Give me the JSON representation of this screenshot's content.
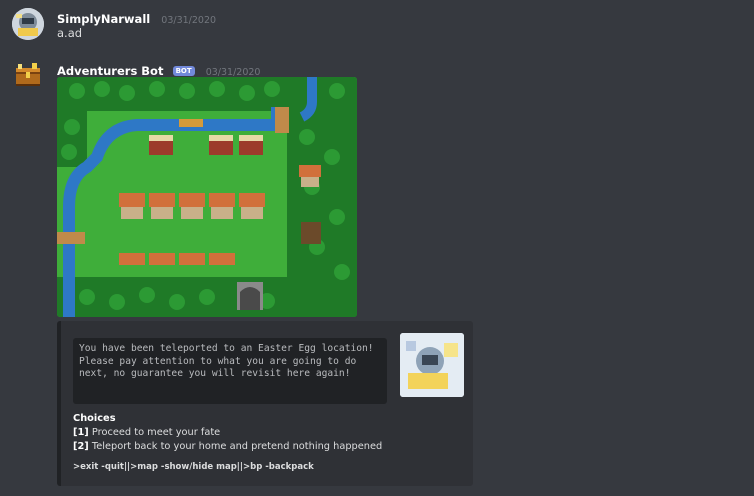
{
  "messages": [
    {
      "username": "SimplyNarwall",
      "timestamp": "03/31/2020",
      "content": "a.ad"
    },
    {
      "username": "Adventurers Bot",
      "bot_tag": "BOT",
      "timestamp": "03/31/2020",
      "embed": {
        "code_text": "You have been teleported to an Easter Egg location! Please pay attention to what you are going to do next, no guarantee you will revisit here again!",
        "choices_title": "Choices",
        "choices": [
          {
            "key": "[1]",
            "text": "Proceed to meet your fate"
          },
          {
            "key": "[2]",
            "text": "Teleport back to your home and pretend nothing happened"
          }
        ],
        "footer": ">exit -quit||>map -show/hide map||>bp -backpack"
      }
    }
  ],
  "colors": {
    "background": "#36393f",
    "embed_bg": "#2f3136",
    "bot_tag": "#7289da",
    "map_grass": "#3fae3a",
    "map_water": "#2e78c6"
  }
}
